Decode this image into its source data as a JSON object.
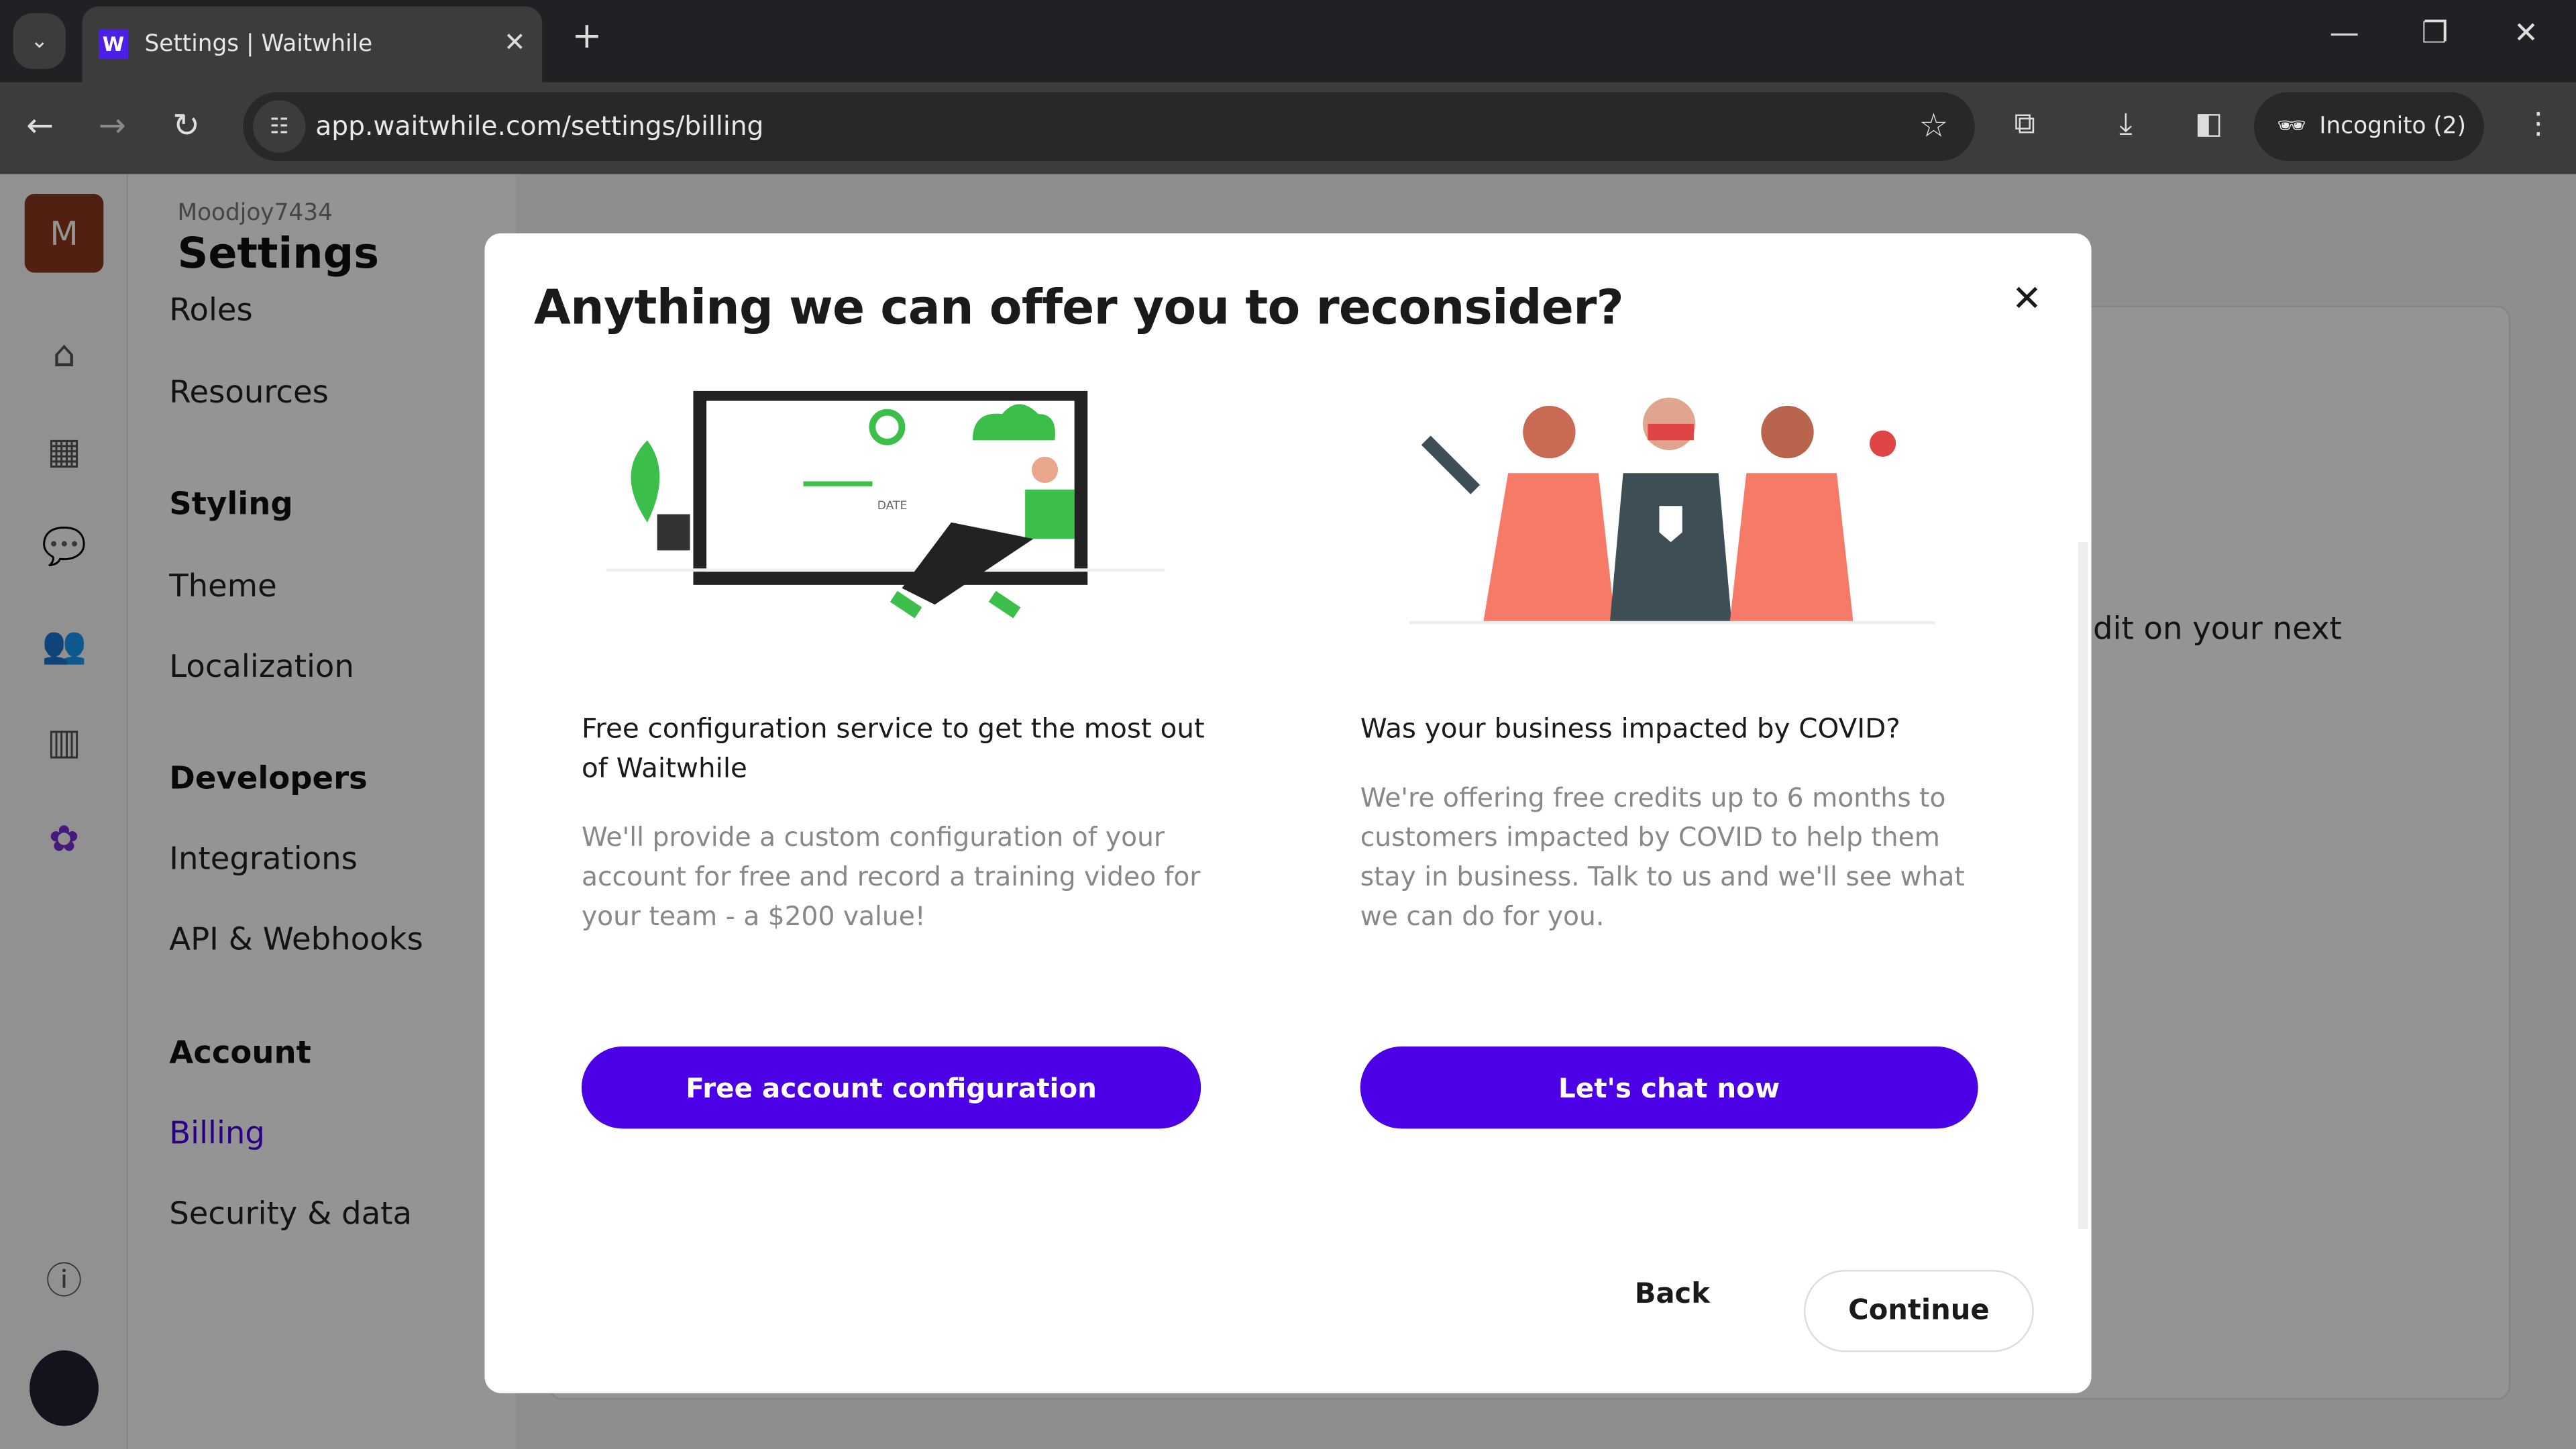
{
  "browser": {
    "tab_title": "Settings | Waitwhile",
    "favicon_letter": "W",
    "url": "app.waitwhile.com/settings/billing",
    "incognito_label": "Incognito (2)"
  },
  "app": {
    "avatar_letter": "M",
    "org_name": "Moodjoy7434",
    "page_title": "Settings",
    "sidebar": {
      "items": [
        {
          "label": "Roles"
        },
        {
          "label": "Resources"
        },
        {
          "label": "Styling",
          "heading": true
        },
        {
          "label": "Theme"
        },
        {
          "label": "Localization"
        },
        {
          "label": "Developers",
          "heading": true
        },
        {
          "label": "Integrations"
        },
        {
          "label": "API & Webhooks"
        },
        {
          "label": "Account",
          "heading": true
        },
        {
          "label": "Billing",
          "active": true
        },
        {
          "label": "Security & data"
        }
      ]
    },
    "background_text": "dit on your next",
    "accent_color": "#4b00e6"
  },
  "modal": {
    "title": "Anything we can offer you to reconsider?",
    "offers": [
      {
        "title": "Free configuration service to get the most out of Waitwhile",
        "description": "We'll provide a custom configuration of your account for free and record a training video for your team - a $200 value!",
        "button": "Free account configuration",
        "illustration_text": "DATE"
      },
      {
        "title": "Was your business impacted by COVID?",
        "description": "We're offering free credits up to 6 months to customers impacted by COVID to help them stay in business. Talk to us and we'll see what we can do for you.",
        "button": "Let's chat now"
      }
    ],
    "back_label": "Back",
    "continue_label": "Continue"
  }
}
